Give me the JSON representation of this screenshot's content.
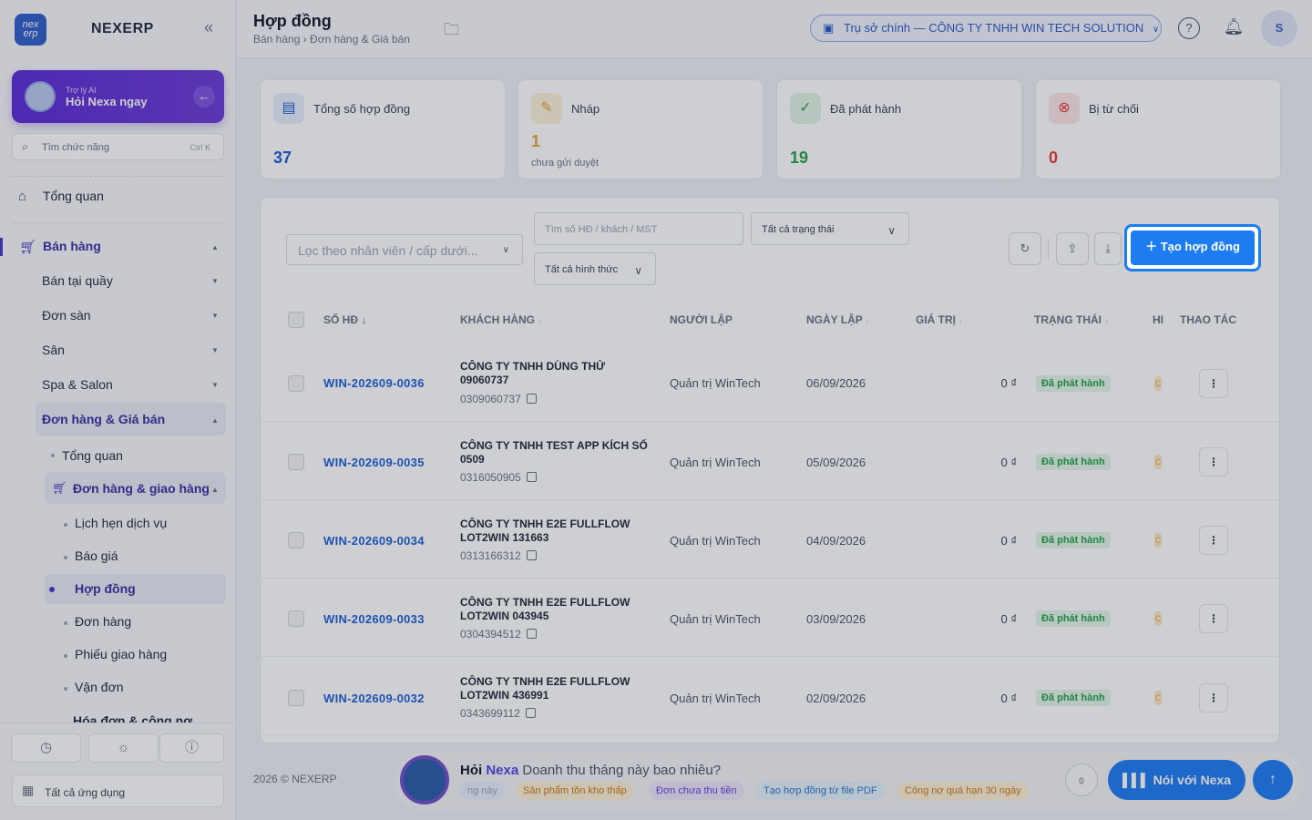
{
  "app": {
    "brand": "NEXERP",
    "logo_text": "nex erp"
  },
  "ai_card": {
    "subtitle": "Trợ lý AI",
    "title": "Hỏi Nexa ngay"
  },
  "search": {
    "placeholder": "Tìm chức năng",
    "shortcut": "Ctrl K"
  },
  "sidebar": {
    "overview": "Tổng quan",
    "sales": "Bán hàng",
    "items": [
      "Bán tại quầy",
      "Đơn sàn",
      "Sân",
      "Spa & Salon",
      "Đơn hàng & Giá bán"
    ],
    "sub_overview": "Tổng quan",
    "orders_delivery": "Đơn hàng & giao hàng",
    "leaves": [
      "Lịch hẹn dịch vụ",
      "Báo giá",
      "Hợp đồng",
      "Đơn hàng",
      "Phiếu giao hàng",
      "Vận đơn"
    ],
    "next_cut": "Hóa đơn & công nợ",
    "all_apps": "Tất cả ứng dụng"
  },
  "header": {
    "title": "Hợp đồng",
    "breadcrumb": "Bán hàng › Đơn hàng & Giá bán",
    "branch": "Trụ sở chính — CÔNG TY TNHH WIN TECH SOLUTION",
    "avatar": "S"
  },
  "stats": [
    {
      "label": "Tổng số hợp đồng",
      "value": "37",
      "sub": "",
      "color": "#1d5fd6"
    },
    {
      "label": "Nháp",
      "value": "1",
      "sub": "chưa gửi duyệt",
      "color": "#e6a23c"
    },
    {
      "label": "Đã phát hành",
      "value": "19",
      "sub": "",
      "color": "#22a04a"
    },
    {
      "label": "Bị từ chối",
      "value": "0",
      "sub": "",
      "color": "#e53935"
    }
  ],
  "filters": {
    "staff": "Lọc theo nhân viên / cấp dưới...",
    "search": "Tìm số HĐ / khách / MST",
    "status": "Tất cả trạng thái",
    "type": "Tất cả hình thức",
    "create": "Tạo hợp đồng"
  },
  "table": {
    "headers": [
      "SỐ HĐ",
      "KHÁCH HÀNG",
      "NGƯỜI LẬP",
      "NGÀY LẬP",
      "GIÁ TRỊ",
      "TRẠNG THÁI",
      "HI",
      "THAO TÁC"
    ],
    "rows": [
      {
        "code": "WIN-202609-0036",
        "customer": "CÔNG TY TNHH DÙNG THỬ 09060737",
        "mst": "0309060737",
        "creator": "Quản trị WinTech",
        "date": "06/09/2026",
        "value": "0 ₫",
        "status": "Đã phát hành",
        "hi": "C"
      },
      {
        "code": "WIN-202609-0035",
        "customer": "CÔNG TY TNHH TEST APP KÍCH SỐ 0509",
        "mst": "0316050905",
        "creator": "Quản trị WinTech",
        "date": "05/09/2026",
        "value": "0 ₫",
        "status": "Đã phát hành",
        "hi": "C"
      },
      {
        "code": "WIN-202609-0034",
        "customer": "CÔNG TY TNHH E2E FULLFLOW LOT2WIN 131663",
        "mst": "0313166312",
        "creator": "Quản trị WinTech",
        "date": "04/09/2026",
        "value": "0 ₫",
        "status": "Đã phát hành",
        "hi": "C"
      },
      {
        "code": "WIN-202609-0033",
        "customer": "CÔNG TY TNHH E2E FULLFLOW LOT2WIN 043945",
        "mst": "0304394512",
        "creator": "Quản trị WinTech",
        "date": "03/09/2026",
        "value": "0 ₫",
        "status": "Đã phát hành",
        "hi": "C"
      },
      {
        "code": "WIN-202609-0032",
        "customer": "CÔNG TY TNHH E2E FULLFLOW LOT2WIN 436991",
        "mst": "0343699112",
        "creator": "Quản trị WinTech",
        "date": "02/09/2026",
        "value": "0 ₫",
        "status": "Đã phát hành",
        "hi": "C"
      }
    ]
  },
  "footer": {
    "copyright": "2026 © NEXERP"
  },
  "nexa": {
    "ask": "Hỏi",
    "name": "Nexa",
    "prompt": "Doanh thu tháng này bao nhiêu?",
    "chips": [
      "ng này",
      "Sản phẩm tồn kho thấp",
      "Đơn chưa thu tiền",
      "Tạo hợp đồng từ file PDF",
      "Công nợ quá hạn 30 ngày"
    ],
    "talk": "Nói với Nexa"
  }
}
